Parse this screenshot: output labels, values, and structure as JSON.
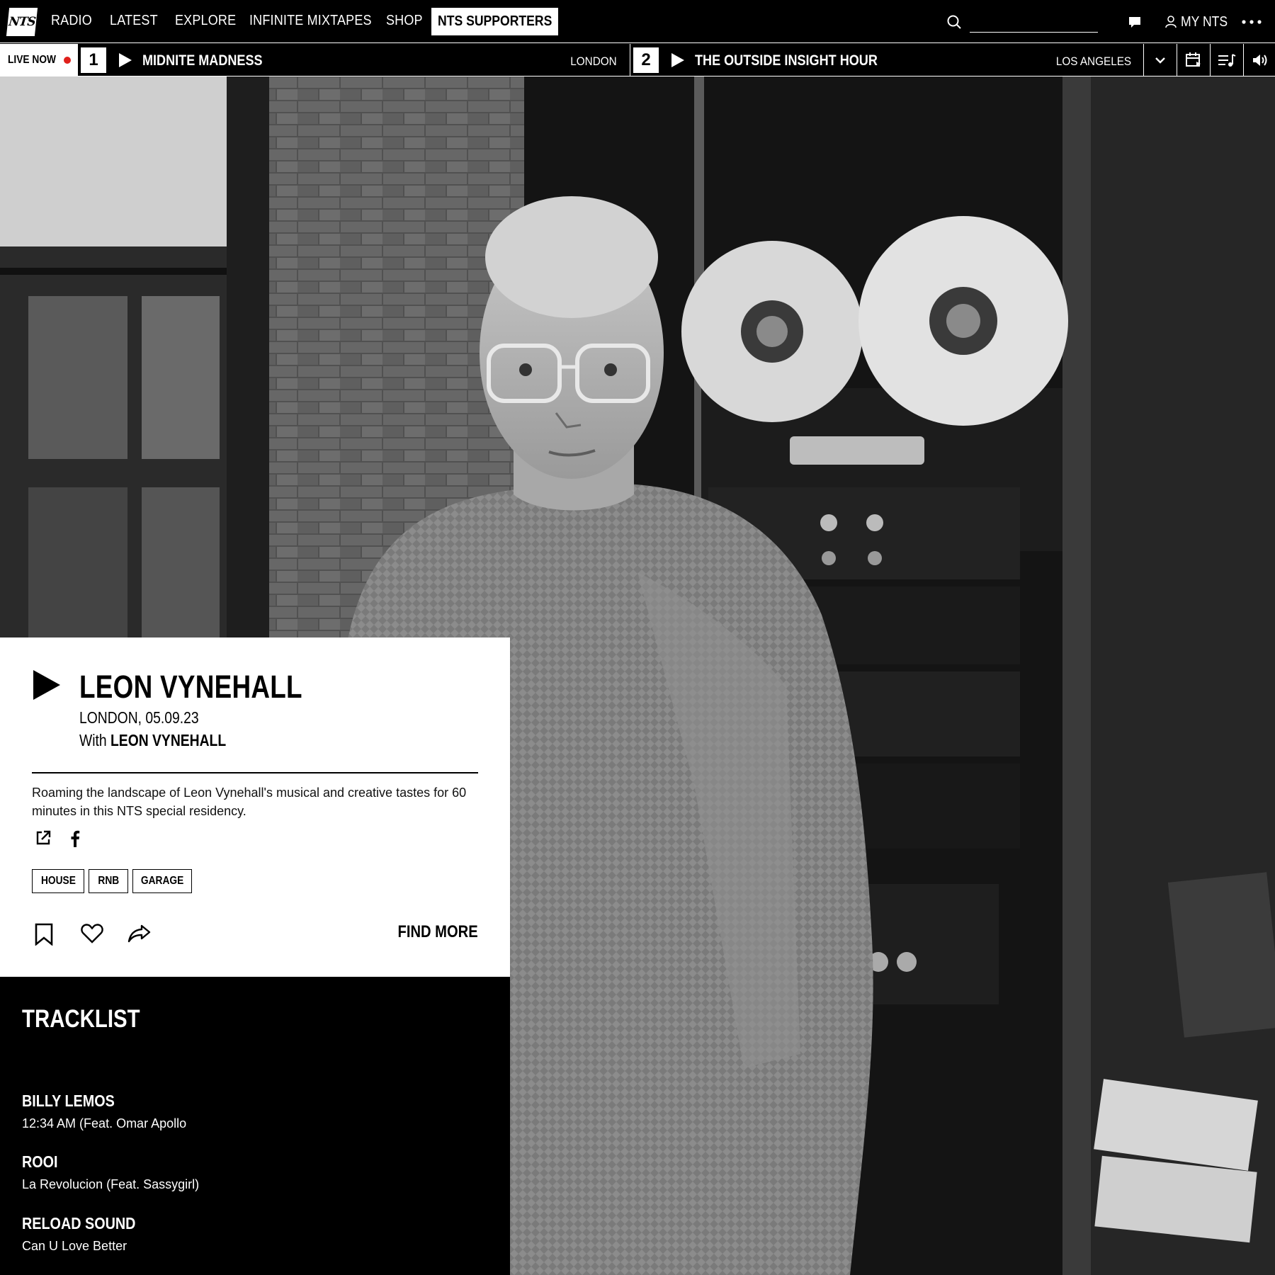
{
  "nav": {
    "logo": "NTS",
    "items": [
      "RADIO",
      "LATEST",
      "EXPLORE",
      "INFINITE MIXTAPES",
      "SHOP"
    ],
    "supporters": "NTS SUPPORTERS",
    "search_value": "",
    "my_nts": "MY NTS"
  },
  "live": {
    "label": "LIVE NOW",
    "channels": [
      {
        "number": "1",
        "title": "MIDNITE MADNESS",
        "location": "LONDON"
      },
      {
        "number": "2",
        "title": "THE OUTSIDE INSIGHT HOUR",
        "location": "LOS ANGELES"
      }
    ]
  },
  "show": {
    "title": "LEON VYNEHALL",
    "meta": "LONDON, 05.09.23",
    "with_prefix": "With ",
    "host": "LEON VYNEHALL",
    "description": "Roaming the landscape of Leon Vynehall's musical and creative tastes for 60 minutes in this NTS special residency.",
    "genres": [
      "HOUSE",
      "RNB",
      "GARAGE"
    ],
    "find_more": "FIND MORE"
  },
  "tracklist": {
    "heading": "TRACKLIST",
    "tracks": [
      {
        "artist": "BILLY LEMOS",
        "title": "12:34 AM (Feat. Omar Apollo"
      },
      {
        "artist": "ROOI",
        "title": "La Revolucion (Feat. Sassygirl)"
      },
      {
        "artist": "RELOAD SOUND",
        "title": "Can U Love Better"
      }
    ]
  },
  "colors": {
    "live_dot": "#e0201b",
    "background": "#000000",
    "card": "#ffffff"
  },
  "icons": [
    "search-icon",
    "chat-icon",
    "user-icon",
    "more-icon",
    "play-icon",
    "chevron-down-icon",
    "calendar-icon",
    "playlist-icon",
    "volume-icon",
    "external-link-icon",
    "facebook-icon",
    "bookmark-icon",
    "heart-icon",
    "share-icon"
  ]
}
